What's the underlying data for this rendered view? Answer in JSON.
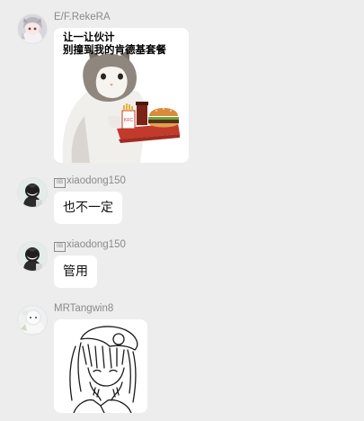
{
  "messages": [
    {
      "sender": "E/F.RekeRA",
      "type": "image",
      "image_caption_line1": "让一让伙计",
      "image_caption_line2": "别撞到我的肯德基套餐",
      "image_icon": "cat-holding-kfc-tray-meme"
    },
    {
      "sender_glyph": "0B",
      "sender": "xiaodong150",
      "type": "text",
      "text": "也不一定"
    },
    {
      "sender_glyph": "0B",
      "sender": "xiaodong150",
      "type": "text",
      "text": "管用"
    },
    {
      "sender": "MRTangwin8",
      "type": "image",
      "image_icon": "anime-girl-sketch"
    }
  ],
  "colors": {
    "background": "#ededed",
    "bubble": "#ffffff",
    "name_text": "#8a8a8a"
  }
}
